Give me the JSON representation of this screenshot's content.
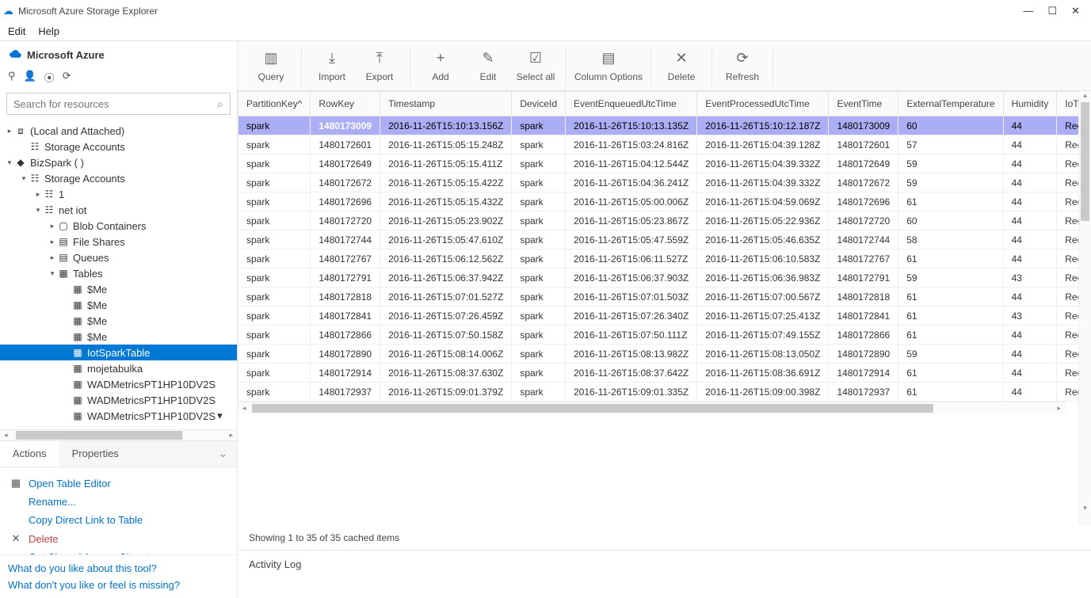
{
  "window": {
    "title": "Microsoft Azure Storage Explorer"
  },
  "menubar": {
    "items": [
      "Edit",
      "Help"
    ]
  },
  "winControls": {
    "min": "—",
    "max": "☐",
    "close": "✕"
  },
  "sidebar": {
    "brand": "Microsoft Azure",
    "search_placeholder": "Search for resources",
    "tree": [
      {
        "indent": 0,
        "arrow": "▸",
        "icon": "⧈",
        "label": "(Local and Attached)"
      },
      {
        "indent": 1,
        "arrow": "",
        "icon": "☷",
        "label": "Storage Accounts"
      },
      {
        "indent": 0,
        "arrow": "▾",
        "icon": "◆",
        "label": "BizSpark (                           )"
      },
      {
        "indent": 1,
        "arrow": "▾",
        "icon": "☷",
        "label": "Storage Accounts"
      },
      {
        "indent": 2,
        "arrow": "▸",
        "icon": "☷",
        "label": "1"
      },
      {
        "indent": 2,
        "arrow": "▾",
        "icon": "☷",
        "label": "net                  iot"
      },
      {
        "indent": 3,
        "arrow": "▸",
        "icon": "▢",
        "label": "Blob Containers"
      },
      {
        "indent": 3,
        "arrow": "▸",
        "icon": "▤",
        "label": "File Shares"
      },
      {
        "indent": 3,
        "arrow": "▸",
        "icon": "▤",
        "label": "Queues"
      },
      {
        "indent": 3,
        "arrow": "▾",
        "icon": "▦",
        "label": "Tables"
      },
      {
        "indent": 4,
        "arrow": "",
        "icon": "▦",
        "label": "$Me"
      },
      {
        "indent": 4,
        "arrow": "",
        "icon": "▦",
        "label": "$Me"
      },
      {
        "indent": 4,
        "arrow": "",
        "icon": "▦",
        "label": "$Me"
      },
      {
        "indent": 4,
        "arrow": "",
        "icon": "▦",
        "label": "$Me"
      },
      {
        "indent": 4,
        "arrow": "",
        "icon": "▦",
        "label": "IotSparkTable",
        "selected": true
      },
      {
        "indent": 4,
        "arrow": "",
        "icon": "▦",
        "label": "mojetabulka"
      },
      {
        "indent": 4,
        "arrow": "",
        "icon": "▦",
        "label": "WADMetricsPT1HP10DV2S"
      },
      {
        "indent": 4,
        "arrow": "",
        "icon": "▦",
        "label": "WADMetricsPT1HP10DV2S"
      },
      {
        "indent": 4,
        "arrow": "",
        "icon": "▦",
        "label": "WADMetricsPT1HP10DV2S",
        "more": true
      }
    ],
    "tabs": {
      "actions": "Actions",
      "properties": "Properties"
    },
    "actions": [
      {
        "icon": "▦",
        "label": "Open Table Editor"
      },
      {
        "icon": "",
        "label": "Rename..."
      },
      {
        "icon": "",
        "label": "Copy Direct Link to Table"
      },
      {
        "icon": "✕",
        "label": "Delete",
        "red": true
      },
      {
        "icon": "",
        "label": "Get Shared Access Signature"
      }
    ],
    "feedback": {
      "q1": "What do you like about this tool?",
      "q2": "What don't you like or feel is missing?"
    }
  },
  "toolbar": {
    "groups": [
      [
        {
          "icon": "▥",
          "label": "Query"
        }
      ],
      [
        {
          "icon": "⤓",
          "label": "Import"
        },
        {
          "icon": "⤒",
          "label": "Export"
        }
      ],
      [
        {
          "icon": "+",
          "label": "Add"
        },
        {
          "icon": "✎",
          "label": "Edit"
        },
        {
          "icon": "☑",
          "label": "Select all"
        }
      ],
      [
        {
          "icon": "▤",
          "label": "Column Options",
          "wide": true
        }
      ],
      [
        {
          "icon": "✕",
          "label": "Delete"
        }
      ],
      [
        {
          "icon": "⟳",
          "label": "Refresh"
        }
      ]
    ]
  },
  "grid": {
    "columns": [
      "PartitionKey^",
      "RowKey",
      "Timestamp",
      "DeviceId",
      "EventEnqueuedUtcTime",
      "EventProcessedUtcTime",
      "EventTime",
      "ExternalTemperature",
      "Humidity",
      "IoTHub"
    ],
    "rows": [
      [
        "spark",
        "1480173009",
        "2016-11-26T15:10:13.156Z",
        "spark",
        "2016-11-26T15:10:13.135Z",
        "2016-11-26T15:10:12.187Z",
        "1480173009",
        "60",
        "44",
        "Record"
      ],
      [
        "spark",
        "1480172601",
        "2016-11-26T15:05:15.248Z",
        "spark",
        "2016-11-26T15:03:24.816Z",
        "2016-11-26T15:04:39.128Z",
        "1480172601",
        "57",
        "44",
        "Record"
      ],
      [
        "spark",
        "1480172649",
        "2016-11-26T15:05:15.411Z",
        "spark",
        "2016-11-26T15:04:12.544Z",
        "2016-11-26T15:04:39.332Z",
        "1480172649",
        "59",
        "44",
        "Record"
      ],
      [
        "spark",
        "1480172672",
        "2016-11-26T15:05:15.422Z",
        "spark",
        "2016-11-26T15:04:36.241Z",
        "2016-11-26T15:04:39.332Z",
        "1480172672",
        "59",
        "44",
        "Record"
      ],
      [
        "spark",
        "1480172696",
        "2016-11-26T15:05:15.432Z",
        "spark",
        "2016-11-26T15:05:00.006Z",
        "2016-11-26T15:04:59.069Z",
        "1480172696",
        "61",
        "44",
        "Record"
      ],
      [
        "spark",
        "1480172720",
        "2016-11-26T15:05:23.902Z",
        "spark",
        "2016-11-26T15:05:23.867Z",
        "2016-11-26T15:05:22.936Z",
        "1480172720",
        "60",
        "44",
        "Record"
      ],
      [
        "spark",
        "1480172744",
        "2016-11-26T15:05:47.610Z",
        "spark",
        "2016-11-26T15:05:47.559Z",
        "2016-11-26T15:05:46.635Z",
        "1480172744",
        "58",
        "44",
        "Record"
      ],
      [
        "spark",
        "1480172767",
        "2016-11-26T15:06:12.562Z",
        "spark",
        "2016-11-26T15:06:11.527Z",
        "2016-11-26T15:06:10.583Z",
        "1480172767",
        "61",
        "44",
        "Record"
      ],
      [
        "spark",
        "1480172791",
        "2016-11-26T15:06:37.942Z",
        "spark",
        "2016-11-26T15:06:37.903Z",
        "2016-11-26T15:06:36.983Z",
        "1480172791",
        "59",
        "43",
        "Record"
      ],
      [
        "spark",
        "1480172818",
        "2016-11-26T15:07:01.527Z",
        "spark",
        "2016-11-26T15:07:01.503Z",
        "2016-11-26T15:07:00.567Z",
        "1480172818",
        "61",
        "44",
        "Record"
      ],
      [
        "spark",
        "1480172841",
        "2016-11-26T15:07:26.459Z",
        "spark",
        "2016-11-26T15:07:26.340Z",
        "2016-11-26T15:07:25.413Z",
        "1480172841",
        "61",
        "43",
        "Record"
      ],
      [
        "spark",
        "1480172866",
        "2016-11-26T15:07:50.158Z",
        "spark",
        "2016-11-26T15:07:50.111Z",
        "2016-11-26T15:07:49.155Z",
        "1480172866",
        "61",
        "44",
        "Record"
      ],
      [
        "spark",
        "1480172890",
        "2016-11-26T15:08:14.006Z",
        "spark",
        "2016-11-26T15:08:13.982Z",
        "2016-11-26T15:08:13.050Z",
        "1480172890",
        "59",
        "44",
        "Record"
      ],
      [
        "spark",
        "1480172914",
        "2016-11-26T15:08:37.630Z",
        "spark",
        "2016-11-26T15:08:37.642Z",
        "2016-11-26T15:08:36.691Z",
        "1480172914",
        "61",
        "44",
        "Record"
      ],
      [
        "spark",
        "1480172937",
        "2016-11-26T15:09:01.379Z",
        "spark",
        "2016-11-26T15:09:01.335Z",
        "2016-11-26T15:09:00.398Z",
        "1480172937",
        "61",
        "44",
        "Record"
      ]
    ],
    "status": "Showing 1 to 35 of 35 cached items"
  },
  "activityLog": {
    "title": "Activity Log"
  }
}
